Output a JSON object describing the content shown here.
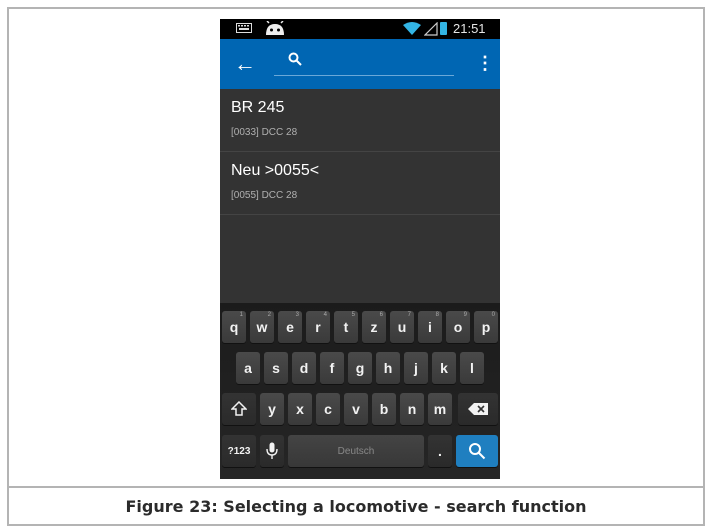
{
  "status_bar": {
    "time": "21:51"
  },
  "toolbar": {
    "back_icon": "arrow-left-icon",
    "search_icon": "search-icon",
    "menu_icon": "overflow-menu-icon",
    "search_value": ""
  },
  "locomotives": [
    {
      "name": "BR 245",
      "details": "[0033]  DCC 28"
    },
    {
      "name": "Neu >0055<",
      "details": "[0055]  DCC 28"
    }
  ],
  "keyboard": {
    "row1": [
      {
        "k": "q",
        "h": "1"
      },
      {
        "k": "w",
        "h": "2"
      },
      {
        "k": "e",
        "h": "3"
      },
      {
        "k": "r",
        "h": "4"
      },
      {
        "k": "t",
        "h": "5"
      },
      {
        "k": "z",
        "h": "6"
      },
      {
        "k": "u",
        "h": "7"
      },
      {
        "k": "i",
        "h": "8"
      },
      {
        "k": "o",
        "h": "9"
      },
      {
        "k": "p",
        "h": "0"
      }
    ],
    "row2": [
      "a",
      "s",
      "d",
      "f",
      "g",
      "h",
      "j",
      "k",
      "l"
    ],
    "row3": [
      "y",
      "x",
      "c",
      "v",
      "b",
      "n",
      "m"
    ],
    "symbols_key": "?123",
    "space_label": "Deutsch",
    "period_key": "."
  },
  "caption": "Figure 23: Selecting a locomotive - search function"
}
